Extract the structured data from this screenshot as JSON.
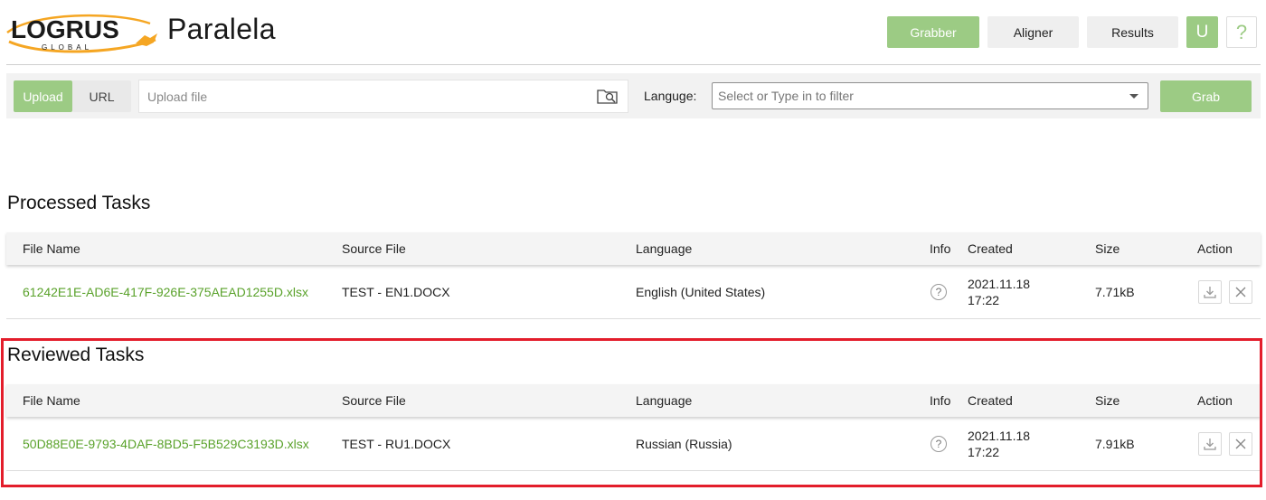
{
  "app": {
    "title": "Paralela",
    "logo_text": "LOGRUS",
    "logo_subtext": "GLOBAL"
  },
  "nav": {
    "grabber": "Grabber",
    "aligner": "Aligner",
    "results": "Results",
    "user": "U",
    "help": "?"
  },
  "toolbar": {
    "tabs": [
      {
        "label": "Upload",
        "active": true
      },
      {
        "label": "URL",
        "active": false
      }
    ],
    "upload_placeholder": "Upload file",
    "language_label": "Languge:",
    "language_placeholder": "Select or Type in to filter",
    "grab_label": "Grab"
  },
  "columns": {
    "file_name": "File Name",
    "source_file": "Source File",
    "language": "Language",
    "info": "Info",
    "created": "Created",
    "size": "Size",
    "action": "Action"
  },
  "processed": {
    "title": "Processed Tasks",
    "rows": [
      {
        "file_name": "61242E1E-AD6E-417F-926E-375AEAD1255D.xlsx",
        "source_file": "TEST - EN1.DOCX",
        "language": "English (United States)",
        "info": "?",
        "created_date": "2021.11.18",
        "created_time": "17:22",
        "size": "7.71kB"
      }
    ]
  },
  "reviewed": {
    "title": "Reviewed Tasks",
    "rows": [
      {
        "file_name": "50D88E0E-9793-4DAF-8BD5-F5B529C3193D.xlsx",
        "source_file": "TEST - RU1.DOCX",
        "language": "Russian (Russia)",
        "info": "?",
        "created_date": "2021.11.18",
        "created_time": "17:22",
        "size": "7.91kB"
      }
    ]
  },
  "colors": {
    "accent": "#9ccb84",
    "link": "#5aa22b",
    "highlight": "#e31d2b",
    "logo_orange": "#f5a623"
  }
}
